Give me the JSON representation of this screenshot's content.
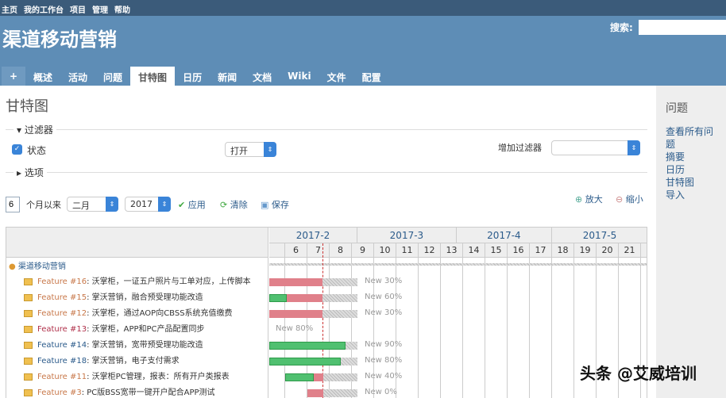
{
  "topbar": [
    "主页",
    "我的工作台",
    "项目",
    "管理",
    "帮助"
  ],
  "header": {
    "title": "渠道移动营销",
    "search_label": "搜索:"
  },
  "tabs": [
    "+",
    "概述",
    "活动",
    "问题",
    "甘特图",
    "日历",
    "新闻",
    "文档",
    "Wiki",
    "文件",
    "配置"
  ],
  "page": {
    "title": "甘特图",
    "filters_legend": "过滤器",
    "status_label": "状态",
    "status_value": "打开",
    "add_filter_label": "增加过滤器",
    "options_legend": "选项",
    "months_count": "6",
    "months_since": "个月以来",
    "month_value": "二月",
    "year_value": "2017",
    "apply": "应用",
    "clear": "清除",
    "save": "保存",
    "zoom_in": "放大",
    "zoom_out": "缩小"
  },
  "sidebar": {
    "title": "问题",
    "links": [
      "查看所有问题",
      "摘要",
      "日历",
      "甘特图",
      "导入"
    ]
  },
  "chart_data": {
    "type": "gantt",
    "months": [
      {
        "label": "2017-2",
        "start": 5.29,
        "end": 9.25
      },
      {
        "label": "2017-3",
        "start": 9.25,
        "end": 13.71
      },
      {
        "label": "2017-4",
        "start": 13.71,
        "end": 18
      },
      {
        "label": "2017-5",
        "start": 18,
        "end": 22.32
      }
    ],
    "weeks": [
      "",
      "6",
      "7",
      "8",
      "9",
      "10",
      "11",
      "12",
      "13",
      "14",
      "15",
      "16",
      "17",
      "18",
      "19",
      "20",
      "21",
      "2"
    ],
    "today": 7.68,
    "project": "渠道移动营销",
    "tasks": [
      {
        "id": "Feature #16",
        "title": ": 沃掌柜，一证五户照片与工单对应，上传脚本",
        "status": "New 30%",
        "color": "#c8784a",
        "start": 5.29,
        "end": 9.25,
        "green": 5.29,
        "red": 7.68
      },
      {
        "id": "Feature #15",
        "title": ": 掌沃营销，融合预受理功能改造",
        "status": "New 60%",
        "color": "#c8784a",
        "start": 5.29,
        "end": 9.25,
        "green": 6.07,
        "red": 7.68
      },
      {
        "id": "Feature #12",
        "title": ": 沃掌柜，通过AOP向CBSS系统充值缴费",
        "status": "New 30%",
        "color": "#c8784a",
        "start": 5.29,
        "end": 9.25,
        "green": 5.29,
        "red": 7.68
      },
      {
        "id": "Feature #13",
        "title": ": 沃掌柜，APP和PC产品配置同步",
        "status": "New 80%",
        "color": "#b0304a",
        "start": null,
        "end": null,
        "green": null,
        "red": null
      },
      {
        "id": "Feature #14",
        "title": ": 掌沃营销，宽带预受理功能改造",
        "status": "New 90%",
        "color": "#2a5a8a",
        "start": 5.29,
        "end": 9.25,
        "green": 8.71,
        "red": 8.71
      },
      {
        "id": "Feature #18",
        "title": ": 掌沃营销，电子支付需求",
        "status": "New 80%",
        "color": "#2a5a8a",
        "start": 5.29,
        "end": 9.25,
        "green": 8.5,
        "red": 8.5
      },
      {
        "id": "Feature #11",
        "title": ": 沃掌柜PC管理，报表：所有开户类报表",
        "status": "New 40%",
        "color": "#c8784a",
        "start": 6,
        "end": 9.25,
        "green": 7.29,
        "red": 7.71
      },
      {
        "id": "Feature #3",
        "title": ": PC版BSS宽带一键开户配合APP测试",
        "status": "New 0%",
        "color": "#c8784a",
        "start": 7,
        "end": 9.25,
        "green": 7,
        "red": 7.71
      }
    ]
  },
  "watermark": "头条 @艾威培训"
}
